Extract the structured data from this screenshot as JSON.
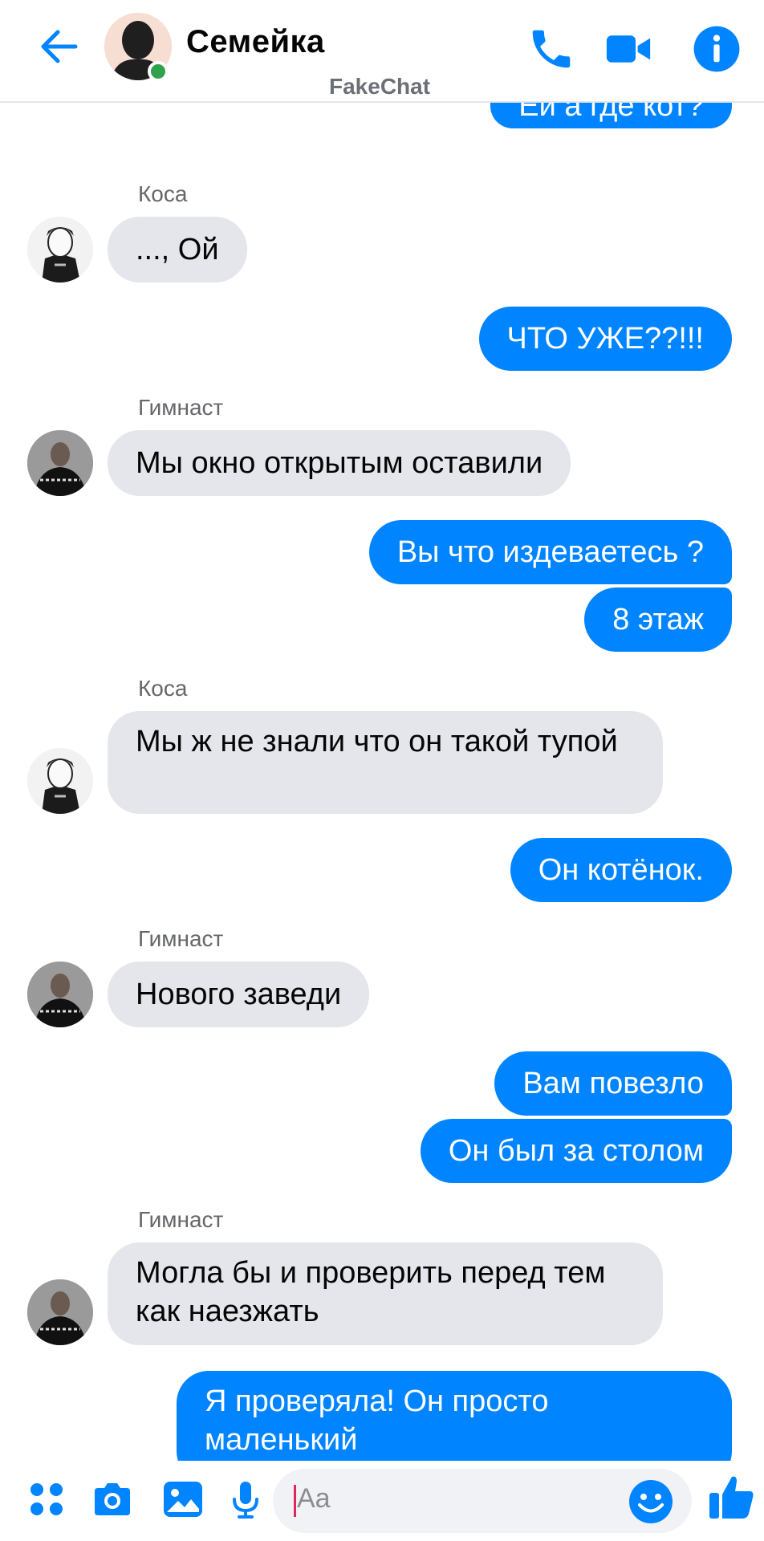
{
  "header": {
    "title": "Семейка",
    "watermark": "FakeChat"
  },
  "messages": [
    {
      "id": "m1",
      "dir": "out",
      "text": "Ей а где кот?"
    },
    {
      "id": "m2",
      "dir": "in",
      "sender": "Коса",
      "text": "..., Ой"
    },
    {
      "id": "m3",
      "dir": "out",
      "text": "ЧТО УЖЕ??!!!"
    },
    {
      "id": "m4",
      "dir": "in",
      "sender": "Гимнаст",
      "text": "Мы окно открытым оставили"
    },
    {
      "id": "m5",
      "dir": "out",
      "text": "Вы что издеваетесь ?"
    },
    {
      "id": "m6",
      "dir": "out",
      "text": "8 этаж"
    },
    {
      "id": "m7",
      "dir": "in",
      "sender": "Коса",
      "text": "Мы ж не знали что он такой тупой"
    },
    {
      "id": "m8",
      "dir": "out",
      "text": "Он котёнок."
    },
    {
      "id": "m9",
      "dir": "in",
      "sender": "Гимнаст",
      "text": "Нового заведи"
    },
    {
      "id": "m10",
      "dir": "out",
      "text": "Вам повезло"
    },
    {
      "id": "m11",
      "dir": "out",
      "text": "Он был за столом"
    },
    {
      "id": "m12",
      "dir": "in",
      "sender": "Гимнаст",
      "text": "Могла бы и проверить перед тем как наезжать"
    },
    {
      "id": "m13",
      "dir": "out",
      "text": "Я проверяла! Он просто маленький"
    }
  ],
  "composer": {
    "placeholder": "Aa"
  },
  "colors": {
    "accent": "#0084ff",
    "incoming_bubble": "#e4e6eb",
    "online": "#31a24c"
  },
  "icons": [
    "back-arrow-icon",
    "phone-icon",
    "video-camera-icon",
    "info-icon",
    "apps-icon",
    "camera-icon",
    "image-icon",
    "microphone-icon",
    "emoji-icon",
    "thumbs-up-icon"
  ]
}
